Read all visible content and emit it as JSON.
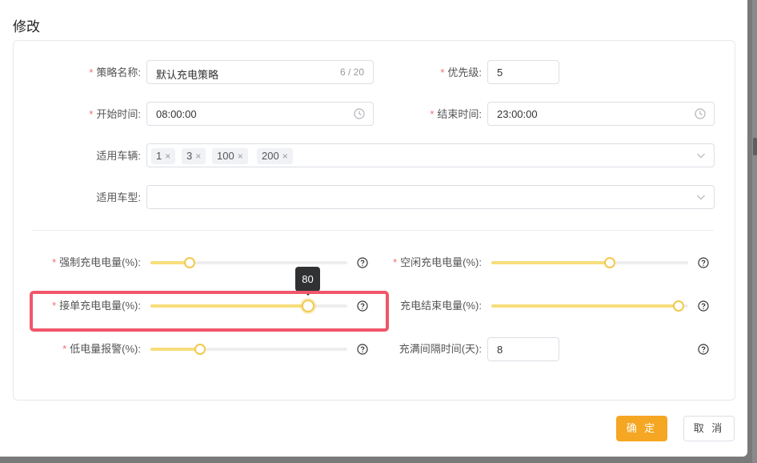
{
  "dialog": {
    "title": "修改"
  },
  "form": {
    "strategy_name": {
      "label": "策略名称:",
      "value": "默认充电策略",
      "count": "6 / 20"
    },
    "priority": {
      "label": "优先级:",
      "value": "5"
    },
    "start_time": {
      "label": "开始时间:",
      "value": "08:00:00"
    },
    "end_time": {
      "label": "结束时间:",
      "value": "23:00:00"
    },
    "vehicles": {
      "label": "适用车辆:",
      "tags": [
        "1",
        "3",
        "100",
        "200"
      ],
      "tag_close": "×"
    },
    "vehicle_type": {
      "label": "适用车型:",
      "value": ""
    }
  },
  "sliders": {
    "forced_charge": {
      "label": "强制充电电量(%):",
      "value": 20
    },
    "idle_charge": {
      "label": "空闲充电电量(%):",
      "value": 60
    },
    "order_charge": {
      "label": "接单充电电量(%):",
      "value": 80,
      "tooltip": "80"
    },
    "charge_end": {
      "label": "充电结束电量(%):",
      "value": 95
    },
    "low_alarm": {
      "label": "低电量报警(%):",
      "value": 25
    }
  },
  "full_interval": {
    "label": "充满间隔时间(天):",
    "value": "8"
  },
  "buttons": {
    "confirm": "确 定",
    "cancel": "取 消"
  },
  "colors": {
    "accent": "#f5a623",
    "required": "#f56c6c",
    "highlight": "#f0566a",
    "slider_fill": "#f7de7b"
  }
}
